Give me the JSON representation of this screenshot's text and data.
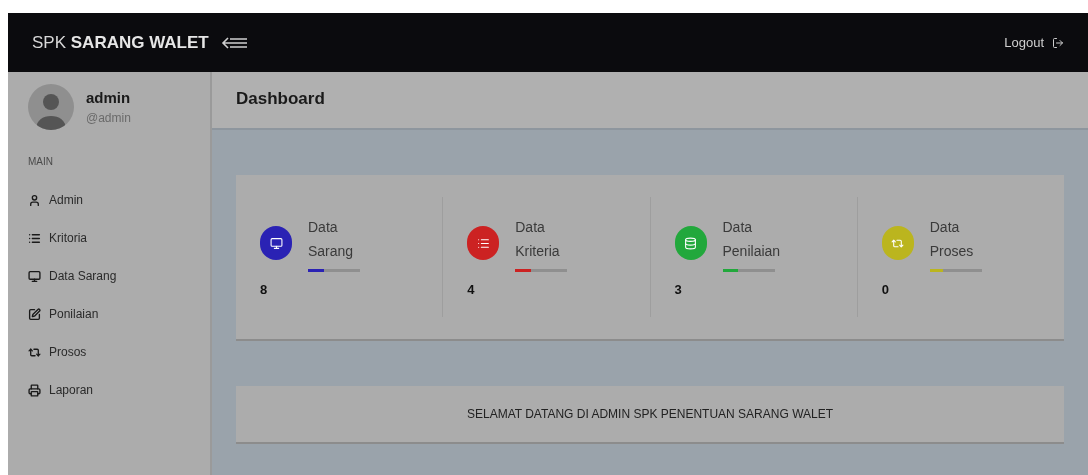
{
  "header": {
    "brand_prefix": "SPK",
    "brand_name": "SARANG WALET",
    "logout": "Logout"
  },
  "sidebar": {
    "user": {
      "name": "admin",
      "handle": "@admin"
    },
    "section": "MAIN",
    "items": [
      {
        "label": "Admin"
      },
      {
        "label": "Kritoria"
      },
      {
        "label": "Data Sarang"
      },
      {
        "label": "Ponilaian"
      },
      {
        "label": "Prosos"
      },
      {
        "label": "Laporan"
      }
    ]
  },
  "page_title": "Dashboard",
  "stats": [
    {
      "title_line1": "Data",
      "title_line2": "Sarang",
      "value": "8",
      "color": "#2a22b4",
      "level": 0.3
    },
    {
      "title_line1": "Data",
      "title_line2": "Kriteria",
      "value": "4",
      "color": "#cc2222",
      "level": 0.3
    },
    {
      "title_line1": "Data",
      "title_line2": "Penilaian",
      "value": "3",
      "color": "#22a83c",
      "level": 0.3
    },
    {
      "title_line1": "Data",
      "title_line2": "Proses",
      "value": "0",
      "color": "#bbb51e",
      "level": 0.25
    }
  ],
  "welcome": "SELAMAT DATANG DI ADMIN SPK PENENTUAN SARANG WALET"
}
